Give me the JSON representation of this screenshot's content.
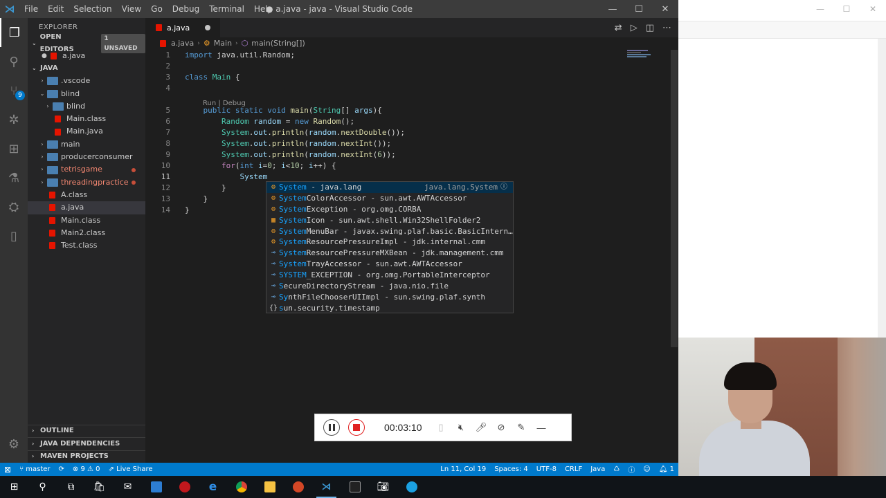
{
  "window": {
    "title": "● a.java - java - Visual Studio Code",
    "menu": [
      "File",
      "Edit",
      "Selection",
      "View",
      "Go",
      "Debug",
      "Terminal",
      "Help"
    ]
  },
  "activity": {
    "source_control_badge": "9"
  },
  "sidebar": {
    "title": "EXPLORER",
    "open_editors": {
      "label": "OPEN EDITORS",
      "unsaved": "1 UNSAVED",
      "items": [
        "a.java"
      ]
    },
    "workspace": {
      "label": "JAVA"
    },
    "tree": [
      {
        "label": ".vscode",
        "kind": "folder",
        "depth": 1,
        "chev": "›"
      },
      {
        "label": "blind",
        "kind": "folder",
        "depth": 1,
        "chev": "⌄"
      },
      {
        "label": "blind",
        "kind": "folder",
        "depth": 2,
        "chev": "›"
      },
      {
        "label": "Main.class",
        "kind": "java",
        "depth": 2
      },
      {
        "label": "Main.java",
        "kind": "java",
        "depth": 2
      },
      {
        "label": "main",
        "kind": "folder",
        "depth": 1,
        "chev": "›"
      },
      {
        "label": "producerconsumer",
        "kind": "folder",
        "depth": 1,
        "chev": "›"
      },
      {
        "label": "tetrisgame",
        "kind": "folder",
        "depth": 1,
        "chev": "›",
        "modified": true
      },
      {
        "label": "threadingpractice",
        "kind": "folder",
        "depth": 1,
        "chev": "›",
        "modified": true
      },
      {
        "label": "A.class",
        "kind": "java",
        "depth": 1
      },
      {
        "label": "a.java",
        "kind": "java",
        "depth": 1,
        "selected": true
      },
      {
        "label": "Main.class",
        "kind": "java",
        "depth": 1
      },
      {
        "label": "Main2.class",
        "kind": "java",
        "depth": 1
      },
      {
        "label": "Test.class",
        "kind": "java",
        "depth": 1
      }
    ],
    "bottom_sections": [
      "OUTLINE",
      "JAVA DEPENDENCIES",
      "MAVEN PROJECTS"
    ]
  },
  "editor": {
    "tab": {
      "label": "a.java"
    },
    "breadcrumb": [
      "a.java",
      "Main",
      "main(String[])"
    ],
    "codelens": "Run | Debug",
    "lines": [
      {
        "n": "1",
        "html": "<span class=\"kw\">import</span> java.util.Random;"
      },
      {
        "n": "2",
        "html": ""
      },
      {
        "n": "3",
        "html": "<span class=\"kw\">class</span> <span class=\"ty\">Main</span> {"
      },
      {
        "n": "4",
        "html": ""
      },
      {
        "n": "5",
        "html": "    <span class=\"kw\">public</span> <span class=\"kw\">static</span> <span class=\"kw\">void</span> <span class=\"fn\">main</span>(<span class=\"ty\">String</span>[] <span class=\"vr\">args</span>){"
      },
      {
        "n": "6",
        "html": "        <span class=\"ty\">Random</span> <span class=\"vr\">random</span> = <span class=\"kw\">new</span> <span class=\"fn\">Random</span>();"
      },
      {
        "n": "7",
        "html": "        <span class=\"ty\">System</span>.<span class=\"vr\">out</span>.<span class=\"fn\">println</span>(<span class=\"vr\">random</span>.<span class=\"fn\">nextDouble</span>());"
      },
      {
        "n": "8",
        "html": "        <span class=\"ty\">System</span>.<span class=\"vr\">out</span>.<span class=\"fn\">println</span>(<span class=\"vr\">random</span>.<span class=\"fn\">nextInt</span>());"
      },
      {
        "n": "9",
        "html": "        <span class=\"ty\">System</span>.<span class=\"vr\">out</span>.<span class=\"fn\">println</span>(<span class=\"vr\">random</span>.<span class=\"fn\">nextInt</span>(<span class=\"nm\">6</span>));"
      },
      {
        "n": "10",
        "html": "        <span class=\"ctrl\">for</span>(<span class=\"kw\">int</span> <span class=\"vr\">i</span>=<span class=\"nm\">0</span>; <span class=\"vr\">i</span>&lt;<span class=\"nm\">10</span>; <span class=\"vr\">i</span>++) {"
      },
      {
        "n": "11",
        "html": "            <span class=\"vr\">System</span>"
      },
      {
        "n": "12",
        "html": "        }"
      },
      {
        "n": "13",
        "html": "    }"
      },
      {
        "n": "14",
        "html": "}"
      }
    ],
    "current_line": "11"
  },
  "suggest": {
    "items": [
      {
        "icon": "class",
        "hl": "System",
        "rest": " - java.lang",
        "detail": "java.lang.System",
        "selected": true
      },
      {
        "icon": "class",
        "hl": "System",
        "rest": "ColorAccessor - sun.awt.AWTAccessor"
      },
      {
        "icon": "class",
        "hl": "System",
        "rest": "Exception - org.omg.CORBA"
      },
      {
        "icon": "enum",
        "hl": "System",
        "rest": "Icon - sun.awt.shell.Win32ShellFolder2"
      },
      {
        "icon": "class",
        "hl": "System",
        "rest": "MenuBar - javax.swing.plaf.basic.BasicIntern…"
      },
      {
        "icon": "class",
        "hl": "System",
        "rest": "ResourcePressureImpl - jdk.internal.cmm"
      },
      {
        "icon": "interface",
        "hl": "System",
        "rest": "ResourcePressureMXBean - jdk.management.cmm"
      },
      {
        "icon": "interface",
        "hl": "System",
        "rest": "TrayAccessor - sun.awt.AWTAccessor"
      },
      {
        "icon": "interface",
        "hl": "SYSTEM",
        "rest": "_EXCEPTION - org.omg.PortableInterceptor"
      },
      {
        "icon": "interface",
        "hl": "S",
        "rest": "ecureDirectoryStream - java.nio.file"
      },
      {
        "icon": "interface",
        "hl": "Sy",
        "rest": "nthFileChooserUIImpl - sun.swing.plaf.synth"
      },
      {
        "icon": "module",
        "hl": "s",
        "rest": "un.security.timestamp"
      }
    ]
  },
  "statusbar": {
    "branch": "master",
    "problems": "⊗ 9 ⚠ 0",
    "liveshare": "Live Share",
    "position": "Ln 11, Col 19",
    "spaces": "Spaces: 4",
    "encoding": "UTF-8",
    "eol": "CRLF",
    "language": "Java",
    "notifications": "1"
  },
  "recorder": {
    "time": "00:03:10"
  },
  "colors": {
    "accent": "#007acc",
    "editor_bg": "#1e1e1e",
    "sidebar_bg": "#252526",
    "titlebar_bg": "#3c3c3c"
  }
}
